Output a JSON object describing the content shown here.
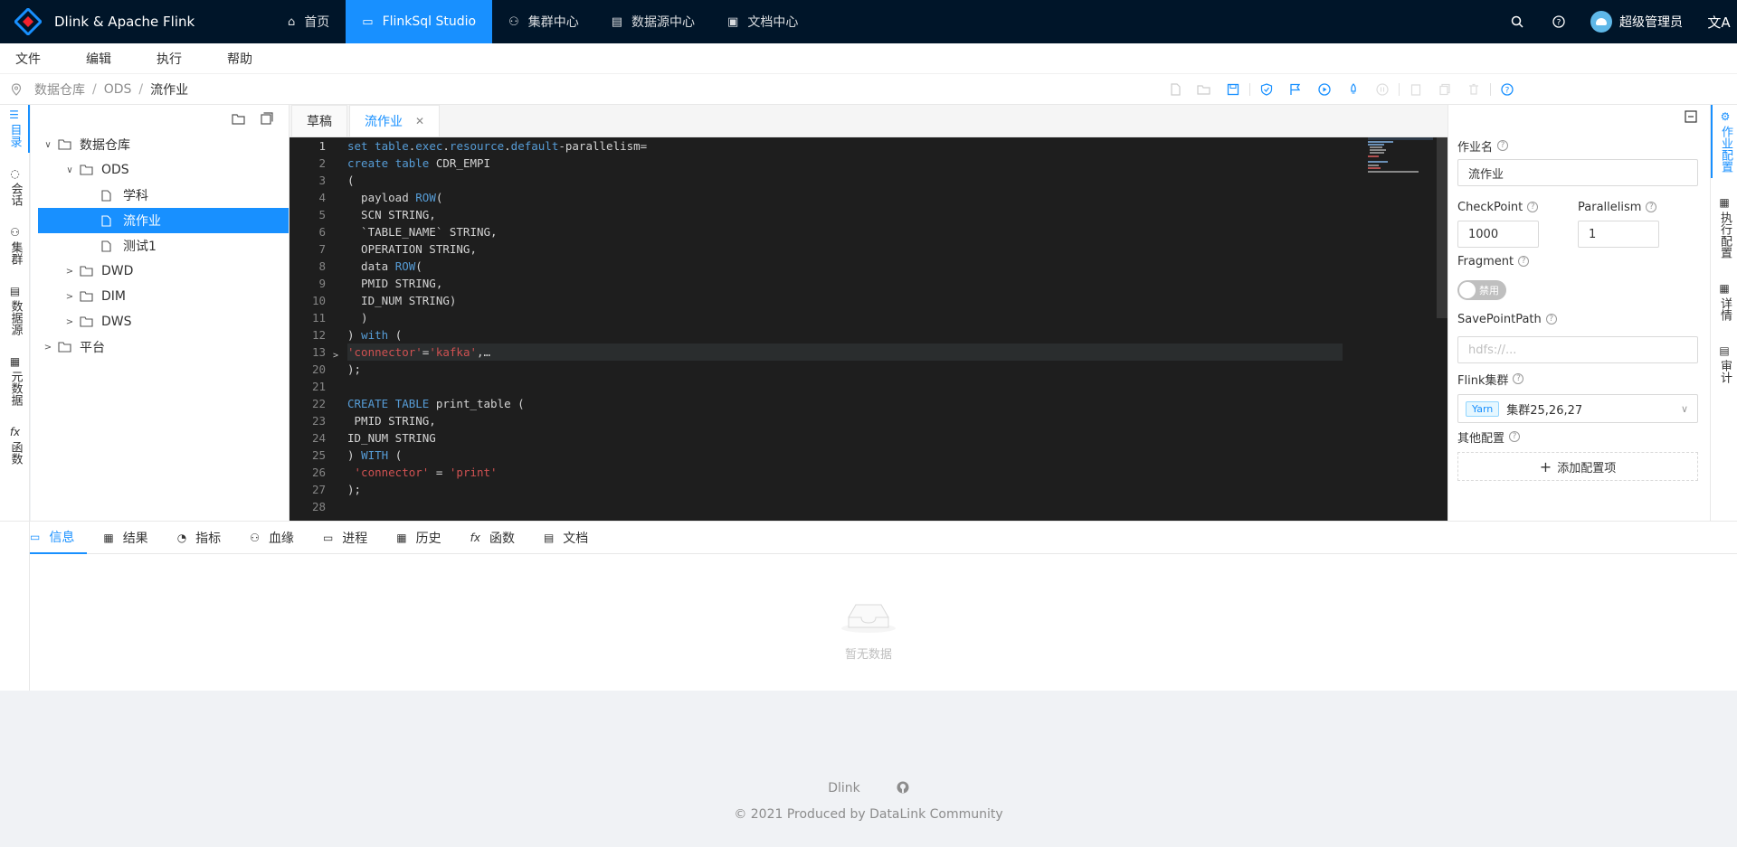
{
  "app": {
    "title": "Dlink & Apache Flink"
  },
  "nav": [
    {
      "label": "首页",
      "icon": "home-icon"
    },
    {
      "label": "FlinkSql Studio",
      "icon": "desktop-icon"
    },
    {
      "label": "集群中心",
      "icon": "cluster-icon"
    },
    {
      "label": "数据源中心",
      "icon": "database-icon"
    },
    {
      "label": "文档中心",
      "icon": "book-icon"
    }
  ],
  "user": {
    "name": "超级管理员"
  },
  "menu": [
    "文件",
    "编辑",
    "执行",
    "帮助"
  ],
  "breadcrumb": [
    "数据仓库",
    "ODS",
    "流作业"
  ],
  "left_rail": [
    {
      "label": "目录",
      "icon": "catalog-icon"
    },
    {
      "label": "会话",
      "icon": "session-icon"
    },
    {
      "label": "集群",
      "icon": "cluster-icon"
    },
    {
      "label": "数据源",
      "icon": "datasource-icon"
    },
    {
      "label": "元数据",
      "icon": "metadata-icon"
    },
    {
      "label": "函数",
      "icon": "function-icon"
    }
  ],
  "tree": [
    {
      "label": "数据仓库",
      "level": 0,
      "expanded": true,
      "type": "folder"
    },
    {
      "label": "ODS",
      "level": 1,
      "expanded": true,
      "type": "folder"
    },
    {
      "label": "学科",
      "level": 2,
      "type": "file"
    },
    {
      "label": "流作业",
      "level": 2,
      "type": "file",
      "selected": true
    },
    {
      "label": "测试1",
      "level": 2,
      "type": "file"
    },
    {
      "label": "DWD",
      "level": 1,
      "expanded": false,
      "type": "folder"
    },
    {
      "label": "DIM",
      "level": 1,
      "expanded": false,
      "type": "folder"
    },
    {
      "label": "DWS",
      "level": 1,
      "expanded": false,
      "type": "folder"
    },
    {
      "label": "平台",
      "level": 0,
      "expanded": false,
      "type": "folder"
    }
  ],
  "tabs": [
    {
      "label": "草稿"
    },
    {
      "label": "流作业"
    }
  ],
  "editor": {
    "line_numbers": [
      "1",
      "2",
      "3",
      "4",
      "5",
      "6",
      "7",
      "8",
      "9",
      "10",
      "11",
      "12",
      "13",
      "20",
      "21",
      "22",
      "23",
      "24",
      "25",
      "26",
      "27",
      "28"
    ],
    "current_line": "1",
    "highlight_line": "13"
  },
  "config": {
    "job_name_label": "作业名",
    "job_name": "流作业",
    "checkpoint_label": "CheckPoint",
    "checkpoint": "1000",
    "parallelism_label": "Parallelism",
    "parallelism": "1",
    "fragment_label": "Fragment",
    "fragment_toggle": "禁用",
    "savepoint_label": "SavePointPath",
    "savepoint_placeholder": "hdfs://...",
    "cluster_label": "Flink集群",
    "cluster_tag": "Yarn",
    "cluster_value": "集群25,26,27",
    "other_label": "其他配置",
    "add_config": "添加配置项"
  },
  "right_rail": [
    {
      "label": "作业配置",
      "icon": "setting-icon"
    },
    {
      "label": "执行配置",
      "icon": "schedule-icon"
    },
    {
      "label": "详情",
      "icon": "calendar-icon"
    },
    {
      "label": "审计",
      "icon": "audit-icon"
    }
  ],
  "bottom_tabs": [
    {
      "label": "信息",
      "icon": "info-icon"
    },
    {
      "label": "结果",
      "icon": "table-icon"
    },
    {
      "label": "指标",
      "icon": "dashboard-icon"
    },
    {
      "label": "血缘",
      "icon": "lineage-icon"
    },
    {
      "label": "进程",
      "icon": "monitor-icon"
    },
    {
      "label": "历史",
      "icon": "history-icon"
    },
    {
      "label": "函数",
      "icon": "function-icon"
    },
    {
      "label": "文档",
      "icon": "doc-icon"
    }
  ],
  "empty_text": "暂无数据",
  "footer": {
    "link": "Dlink",
    "copyright": "2021 Produced by DataLink Community"
  },
  "colors": {
    "primary": "#1890ff",
    "header": "#001529"
  }
}
